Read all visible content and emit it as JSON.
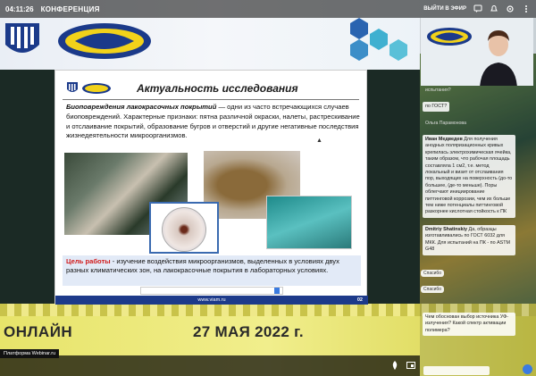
{
  "topbar": {
    "time": "04:11:26",
    "conference": "КОНФЕРЕНЦИЯ",
    "exit_label": "ВЫЙТИ В ЭФИР"
  },
  "slide": {
    "title": "Актуальность исследования",
    "para_lead": "Биоповреждения лакокрасочных покрытий",
    "para_rest": " — одни из часто встречающихся случаев биоповреждений. Характерные признаки: пятна различной окраски, налеты, растрескивание и отслаивание покрытий, образование бугров и отверстий и другие негативные последствия жизнедеятельности микроорганизмов.",
    "goal_label": "Цель работы",
    "goal_text": " - изучение воздействия микроорганизмов, выделенных в условиях двух разных климатических зон, на лакокрасочные покрытия в лабораторных условиях.",
    "footer_url": "www.viam.ru",
    "page_number": "02"
  },
  "banner": {
    "online": "ОНЛАЙН",
    "date": "27 МАЯ 2022 г."
  },
  "platform_label": "Платформа Webinar.ru",
  "chat": {
    "msg_q1": "по ГОСТ?",
    "msg_partial": "испытания?",
    "sender_olga": "Ольга Парамонова",
    "ivan_name": "Иван Медведев",
    "ivan_text": "Для получения анодных поляризационных кривых крепилась электрохимическая ячейка, таким образом, что рабочая площадь составляла 1 см2, т.е. метод локальный и визит от отслаивания пор, выходящих на поверхность (до-то большее, (де-то меньше). Поры облегчают инициирование питтинговой коррозии, чем их больше тем ниже потенциалы питтинговой разкорнее кислотная стойкость к ПК",
    "dmitry_name": "Dmitriy Shatinskiy",
    "dmitry_text": "Да, образцы изготавливались по ГОСТ 6032 для МКК. Для испытаний на ПК - по ASTM G48",
    "pill_1": "Спасибо",
    "pill_2": "Спасибо",
    "bottom_question": "Чем обоснован выбор источника УФ-излучения? Какой спектр активации полимера?"
  }
}
